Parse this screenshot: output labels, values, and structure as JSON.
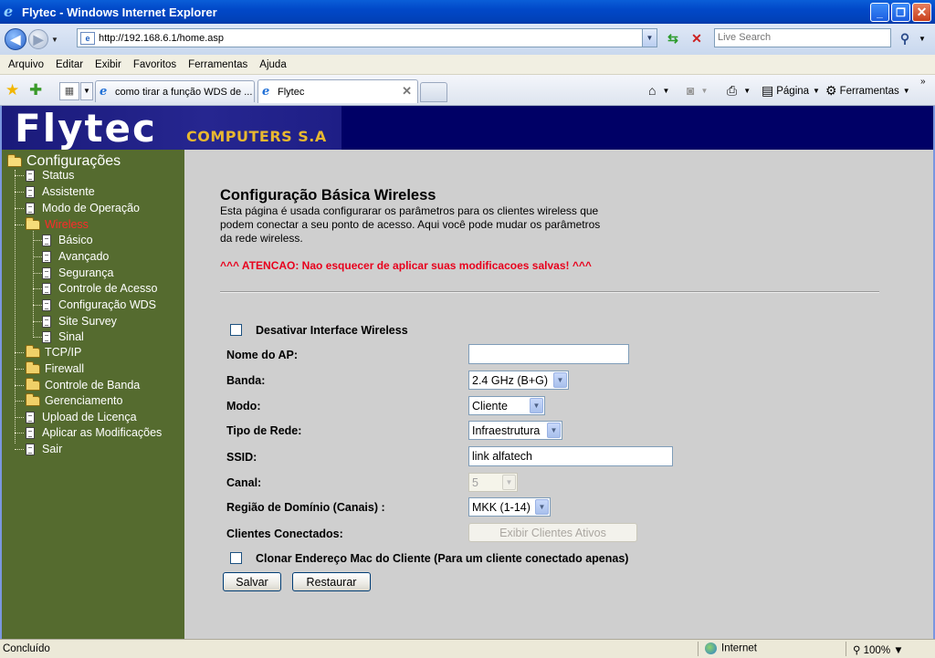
{
  "window": {
    "title": "Flytec - Windows Internet Explorer"
  },
  "address": {
    "url": "http://192.168.6.1/home.asp",
    "search_placeholder": "Live Search"
  },
  "menu": {
    "items": [
      "Arquivo",
      "Editar",
      "Exibir",
      "Favoritos",
      "Ferramentas",
      "Ajuda"
    ]
  },
  "tabs": {
    "items": [
      {
        "label": "como tirar a função WDS de ..."
      },
      {
        "label": "Flytec"
      }
    ],
    "command_bar": {
      "pagina": "Página",
      "ferramentas": "Ferramentas"
    }
  },
  "header": {
    "logo": "Flytec",
    "logo_sub": "COMPUTERS S.A"
  },
  "sidebar": {
    "root": "Configurações",
    "items": [
      {
        "label": "Status",
        "type": "doc"
      },
      {
        "label": "Assistente",
        "type": "doc"
      },
      {
        "label": "Modo de Operação",
        "type": "doc"
      },
      {
        "label": "Wireless",
        "type": "folder-open",
        "active": true
      },
      {
        "label": "Básico",
        "type": "doc"
      },
      {
        "label": "Avançado",
        "type": "doc"
      },
      {
        "label": "Segurança",
        "type": "doc"
      },
      {
        "label": "Controle de Acesso",
        "type": "doc"
      },
      {
        "label": "Configuração WDS",
        "type": "doc"
      },
      {
        "label": "Site Survey",
        "type": "doc"
      },
      {
        "label": "Sinal",
        "type": "doc"
      },
      {
        "label": "TCP/IP",
        "type": "folder"
      },
      {
        "label": "Firewall",
        "type": "folder"
      },
      {
        "label": "Controle de Banda",
        "type": "folder"
      },
      {
        "label": "Gerenciamento",
        "type": "folder"
      },
      {
        "label": "Upload de Licença",
        "type": "doc"
      },
      {
        "label": "Aplicar as Modificações",
        "type": "doc"
      },
      {
        "label": "Sair",
        "type": "doc"
      }
    ]
  },
  "main": {
    "title": "Configuração Básica Wireless",
    "description": "Esta página é usada configurarar os parâmetros para os clientes wireless que podem conectar a seu ponto de acesso. Aqui você pode mudar os parâmetros da rede wireless.",
    "warning": "^^^ ATENCAO: Nao esquecer de aplicar suas modificacoes salvas! ^^^",
    "disable_wireless": {
      "label": "Desativar Interface Wireless",
      "checked": false
    },
    "fields": {
      "ap_name": {
        "label": "Nome do AP:",
        "value": ""
      },
      "banda": {
        "label": "Banda:",
        "value": "2.4 GHz (B+G)"
      },
      "modo": {
        "label": "Modo:",
        "value": "Cliente"
      },
      "tipo_rede": {
        "label": "Tipo de Rede:",
        "value": "Infraestrutura"
      },
      "ssid": {
        "label": "SSID:",
        "value": "link alfatech"
      },
      "canal": {
        "label": "Canal:",
        "value": "5"
      },
      "regiao": {
        "label": "Região de Domínio (Canais) :",
        "value": "MKK (1-14)"
      },
      "clientes": {
        "label": "Clientes Conectados:",
        "button": "Exibir Clientes Ativos"
      }
    },
    "clone_mac": {
      "label": "Clonar Endereço Mac do Cliente (Para um cliente conectado apenas)",
      "checked": false
    },
    "save_label": "Salvar",
    "reset_label": "Restaurar"
  },
  "status": {
    "text": "Concluído",
    "zone": "Internet",
    "zoom": "100%"
  }
}
